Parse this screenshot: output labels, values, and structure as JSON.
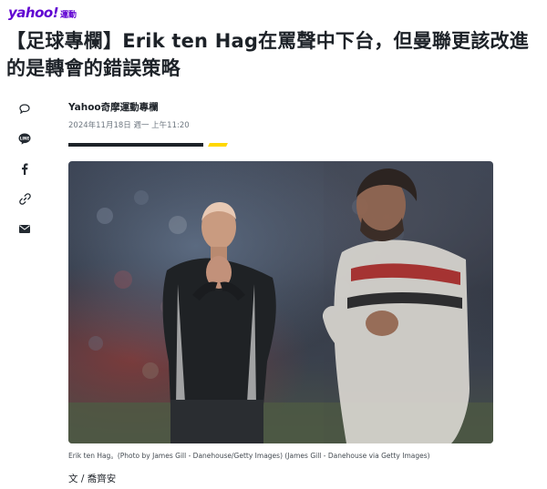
{
  "brand": {
    "logo": "yahoo!",
    "section": "運動"
  },
  "headline": "【足球專欄】Erik ten Hag在罵聲中下台，但曼聯更該改進的是轉會的錯誤策略",
  "share": {
    "icons": [
      "comment-icon",
      "line-icon",
      "facebook-icon",
      "link-icon",
      "mail-icon"
    ]
  },
  "byline": {
    "author": "Yahoo奇摩運動專欄",
    "date": "2024年11月18日 週一 上午11:20"
  },
  "photo": {
    "caption": "Erik ten Hag。(Photo by James Gill - Danehouse/Getty Images) (James Gill - Danehouse via Getty Images)"
  },
  "author_line": "文 / 喬齊安",
  "colors": {
    "brand": "#6001d2",
    "accent": "#ffd700",
    "text": "#1d2228"
  }
}
